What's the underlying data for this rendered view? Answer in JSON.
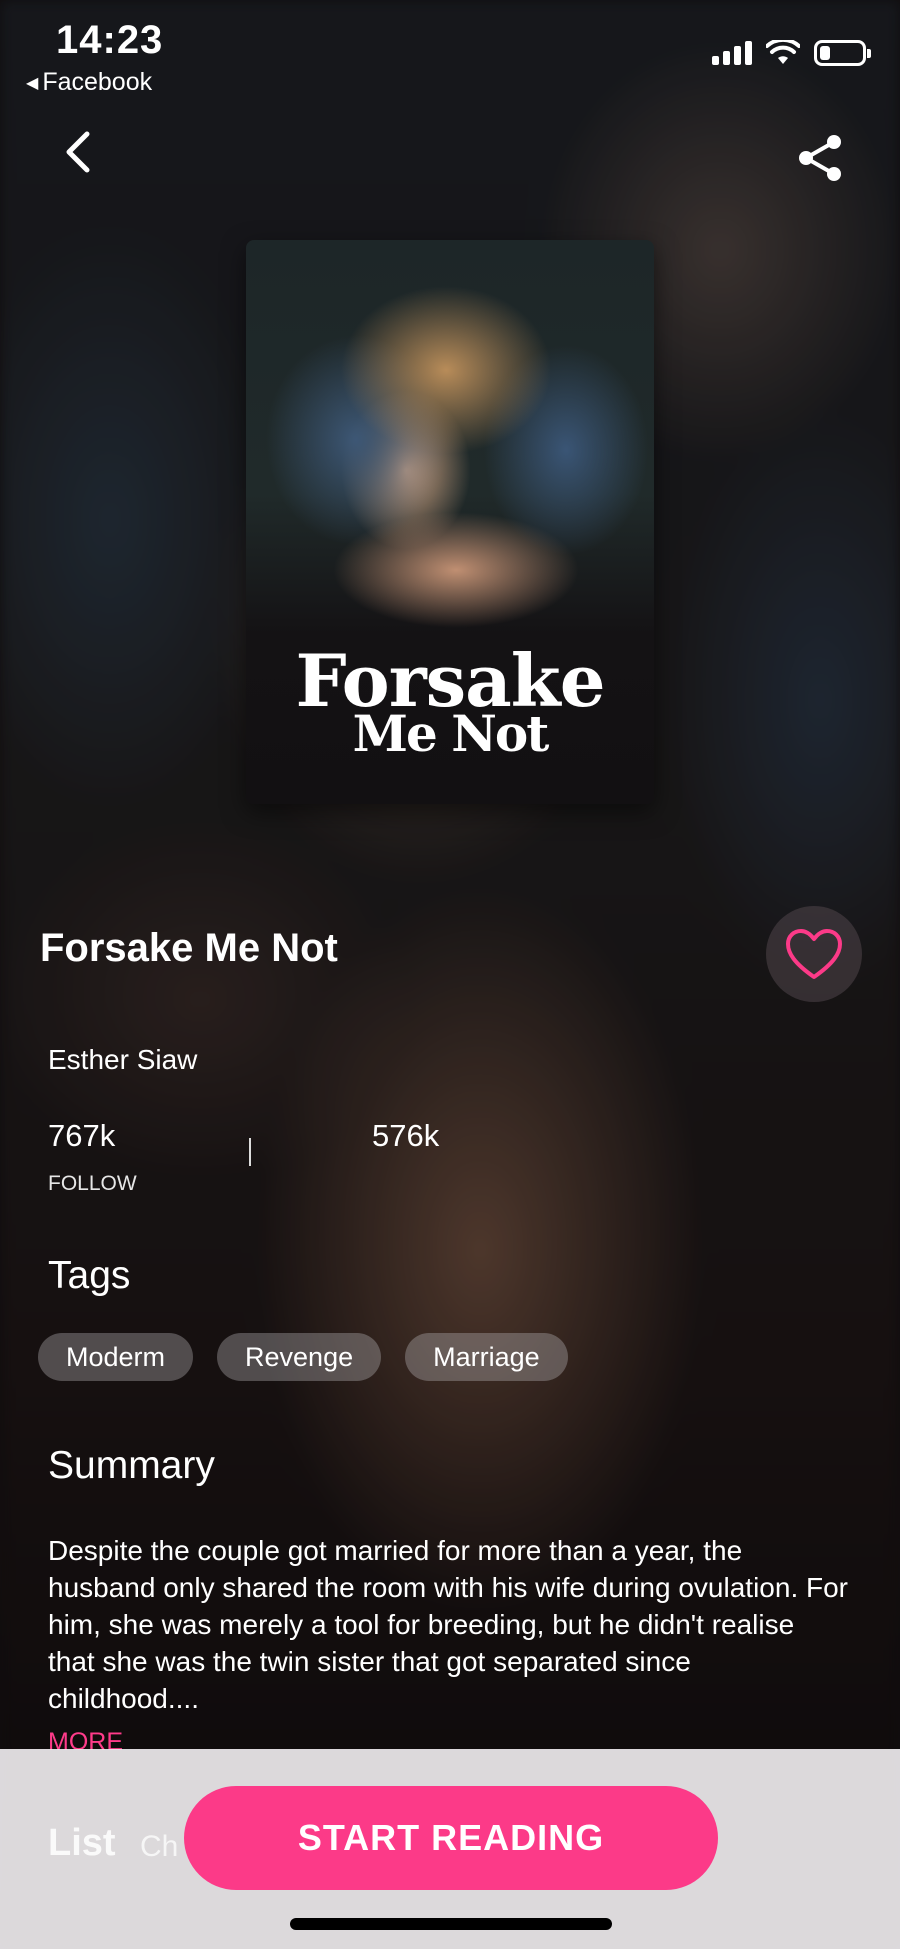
{
  "status_bar": {
    "time": "14:23",
    "back_app": "Facebook"
  },
  "book": {
    "cover_title_line1": "Forsake",
    "cover_title_line2": "Me Not",
    "title": "Forsake Me Not",
    "author": "Esther Siaw",
    "stats": {
      "follow_count": "767k",
      "follow_label": "FOLLOW",
      "second_count": "576k"
    }
  },
  "tags": {
    "heading": "Tags",
    "items": [
      "Moderm",
      "Revenge",
      "Marriage"
    ]
  },
  "summary": {
    "heading": "Summary",
    "text": "Despite the couple got married for more than a year, the husband only shared the room with his wife during ovulation. For him, she was merely a tool for breeding, but he didn't realise that she was the twin sister that got separated since childhood....",
    "more_label": "MORE"
  },
  "list": {
    "heading": "List",
    "partial": "Ch"
  },
  "actions": {
    "start_reading": "START READING"
  },
  "colors": {
    "accent": "#fc3a88"
  }
}
